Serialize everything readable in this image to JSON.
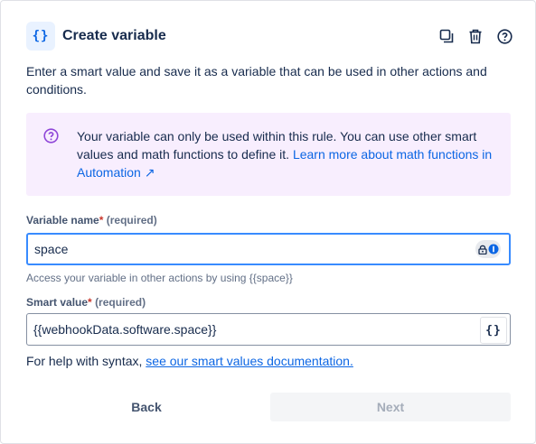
{
  "header": {
    "icon": "curly-braces-icon",
    "icon_glyph": "{}",
    "title": "Create variable",
    "actions": [
      "duplicate-icon",
      "trash-icon",
      "help-icon"
    ]
  },
  "description": "Enter a smart value and save it as a variable that can be used in other actions and conditions.",
  "info": {
    "icon": "question-circle-icon",
    "text": "Your variable can only be used within this rule. You can use other smart values and math functions to define it. ",
    "link_text": "Learn more about math functions in Automation ↗"
  },
  "variable_name": {
    "label": "Variable name",
    "required_marker": "*",
    "required_text": "(required)",
    "value": "space",
    "helper": "Access your variable in other actions by using {{space}}"
  },
  "smart_value": {
    "label": "Smart value",
    "required_marker": "*",
    "required_text": "(required)",
    "value": "{{webhookData.software.space}}",
    "button_glyph": "{}"
  },
  "syntax_help": {
    "text": "For help with syntax, ",
    "link_text": "see our smart values documentation."
  },
  "footer": {
    "back_label": "Back",
    "next_label": "Next"
  },
  "colors": {
    "accent": "#0c66e4",
    "info_bg": "#f8eefe",
    "info_icon": "#8f46d8",
    "required": "#c9372c",
    "focus_border": "#388bff"
  }
}
